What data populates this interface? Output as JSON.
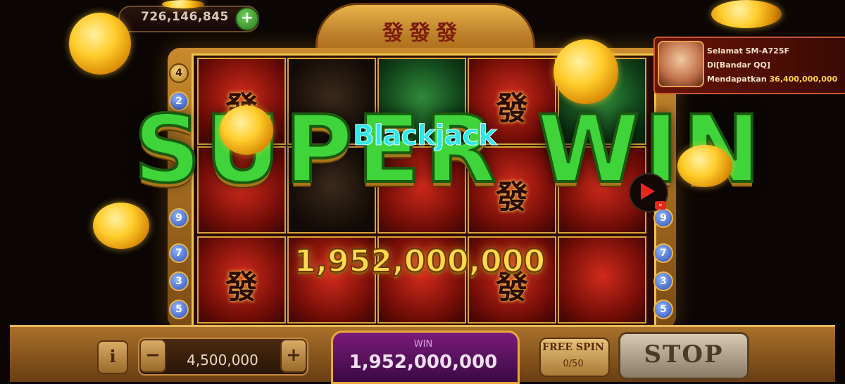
{
  "balance": {
    "value": "726,146,845",
    "add_label": "+"
  },
  "crown": {
    "title": "發發發"
  },
  "side_markers": {
    "left": [
      "4",
      "2",
      "9",
      "7",
      "3",
      "5"
    ],
    "right": [
      "9",
      "7",
      "3",
      "5"
    ]
  },
  "win_banner": {
    "headline": "SUPER WIN",
    "overlay_text": "Blackjack",
    "amount": "1,952,000,000"
  },
  "notification": {
    "line1_prefix": "Selamat",
    "user": "SM-A725F",
    "line2": "Di[Bandar QQ]",
    "line3_prefix": "Mendapatkan",
    "amount": "36,400,000,000"
  },
  "controls": {
    "info_label": "i",
    "minus_label": "−",
    "plus_label": "+",
    "bet_value": "4,500,000",
    "win_label": "WIN",
    "win_amount": "1,952,000,000",
    "free_spin_label": "FREE SPIN",
    "free_spin_count": "0/50",
    "stop_label": "STOP"
  },
  "reel_symbol": "發"
}
